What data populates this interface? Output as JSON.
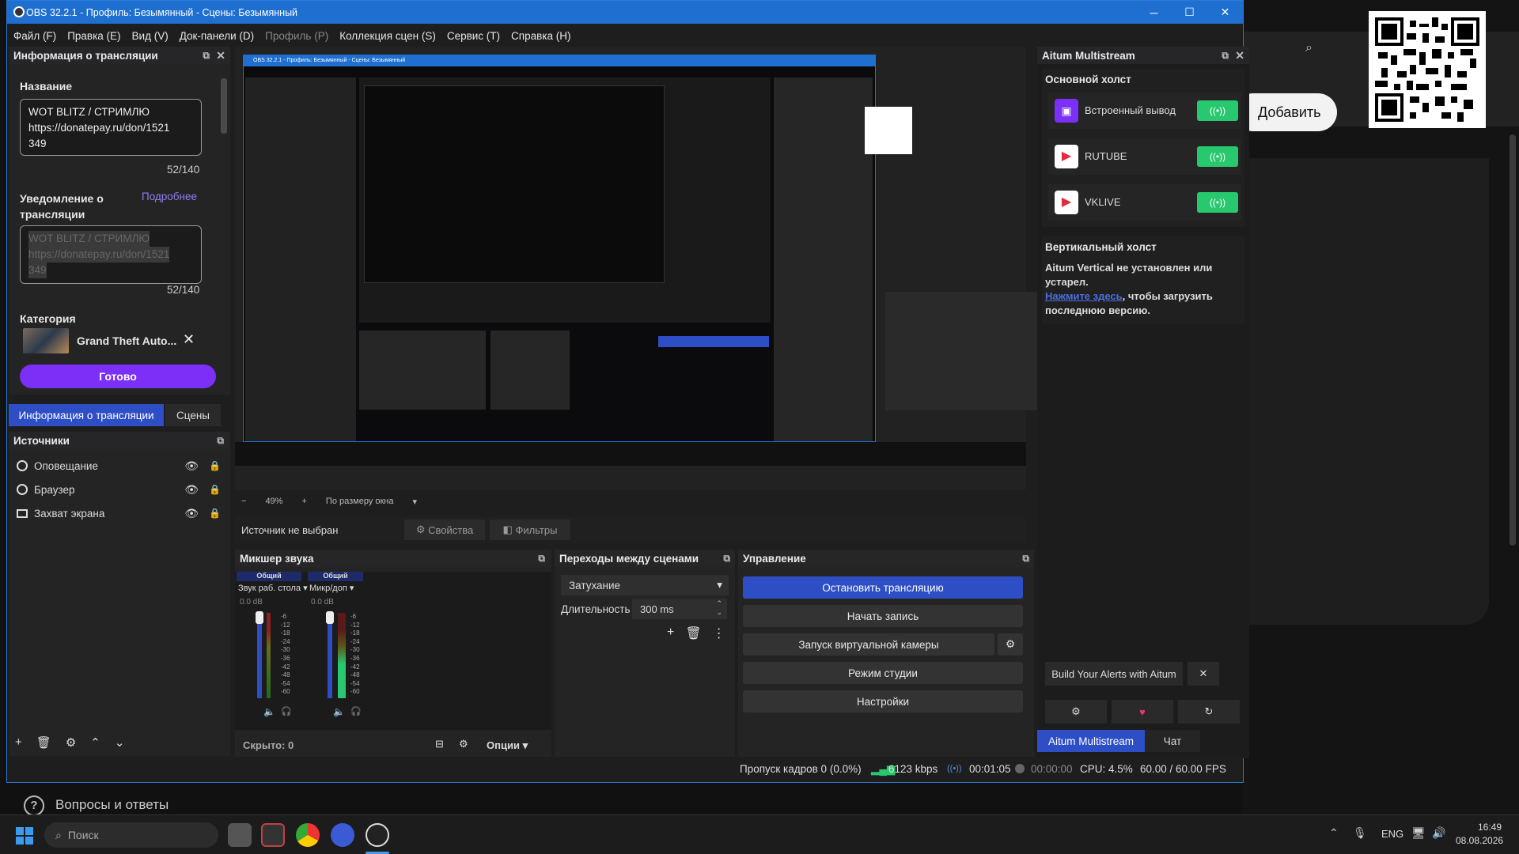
{
  "window": {
    "title": "OBS 32.2.1 - Профиль: Безымянный - Сцены: Безымянный"
  },
  "menu": [
    "Файл (F)",
    "Правка (E)",
    "Вид (V)",
    "Док-панели (D)",
    "Профиль (P)",
    "Коллекция сцен (S)",
    "Сервис (T)",
    "Справка (H)"
  ],
  "info": {
    "panel_title": "Информация о трансляции",
    "name_label": "Название",
    "name_value": [
      "WOT BLITZ / СТРИМЛЮ",
      "https://donatepay.ru/don/1521",
      "349"
    ],
    "name_count": "52/140",
    "notify_label": [
      "Уведомление о",
      "трансляции"
    ],
    "notify_link": "Подробнее",
    "notify_value": [
      "WOT BLITZ / СТРИМЛЮ",
      "https://donatepay.ru/don/1521",
      "349"
    ],
    "notify_count": "52/140",
    "category_label": "Категория",
    "category_value": "Grand Theft Auto...",
    "done_button": "Готово"
  },
  "tabs": [
    "Информация о трансляции",
    "Сцены"
  ],
  "sources": {
    "title": "Источники",
    "items": [
      "Оповещание",
      "Браузер",
      "Захват экрана"
    ]
  },
  "zoom": {
    "value": "49%",
    "fit": "По размеру окна"
  },
  "source_bar": {
    "text": "Источник не выбран",
    "props": "Свойства",
    "filters": "Фильтры"
  },
  "mixer": {
    "title": "Микшер звука",
    "ch": [
      {
        "head": "Общий",
        "name": "Звук раб. стола",
        "db": "0.0 dB"
      },
      {
        "head": "Общий",
        "name": "Микр/доп",
        "db": "0.0 dB"
      }
    ],
    "ticks": [
      "-6",
      "-12",
      "-18",
      "-24",
      "-30",
      "-36",
      "-42",
      "-48",
      "-54",
      "-60"
    ],
    "hidden": "Скрыто: 0",
    "options": "Опции"
  },
  "transitions": {
    "title": "Переходы между сценами",
    "type": "Затухание",
    "duration_label": "Длительность",
    "duration": "300 ms"
  },
  "controls": {
    "title": "Управление",
    "stop": "Остановить трансляцию",
    "record": "Начать запись",
    "vcam": "Запуск виртуальной камеры",
    "studio": "Режим студии",
    "settings": "Настройки"
  },
  "aitum": {
    "title": "Aitum Multistream",
    "main_canvas": "Основной холст",
    "outputs": [
      "Встроенный вывод",
      "RUTUBE",
      "VKLIVE"
    ],
    "vertical": "Вертикальный холст",
    "vertical_msg": [
      "Aitum Vertical не установлен или",
      "устарел."
    ],
    "vertical_link": "Нажмите здесь",
    "vertical_msg2": [
      ", чтобы загрузить",
      "последнюю версию."
    ],
    "alerts": "Build Your Alerts with Aitum",
    "tab1": "Aitum Multistream",
    "tab2": "Чат"
  },
  "status": {
    "dropped": "Пропуск кадров 0 (0.0%)",
    "kbps": "6123 kbps",
    "stream_time": "00:01:05",
    "rec_time": "00:00:00",
    "cpu": "CPU: 4.5%",
    "fps": "60.00 / 60.00 FPS"
  },
  "qa": "Вопросы и ответы",
  "browser_add": "Добавить",
  "taskbar": {
    "search": "Поиск",
    "lang": "ENG",
    "time": "16:49",
    "date": "08.08.2026"
  },
  "preview_nested": {
    "title": "OBS 32.2.1 - Профиль: Безымянный - Сцены: Безымянный"
  },
  "colors": {
    "accent": "#2d4ec5",
    "purple": "#7b2ff7",
    "green": "#28c86f",
    "titlebar": "#1f6fd1"
  }
}
